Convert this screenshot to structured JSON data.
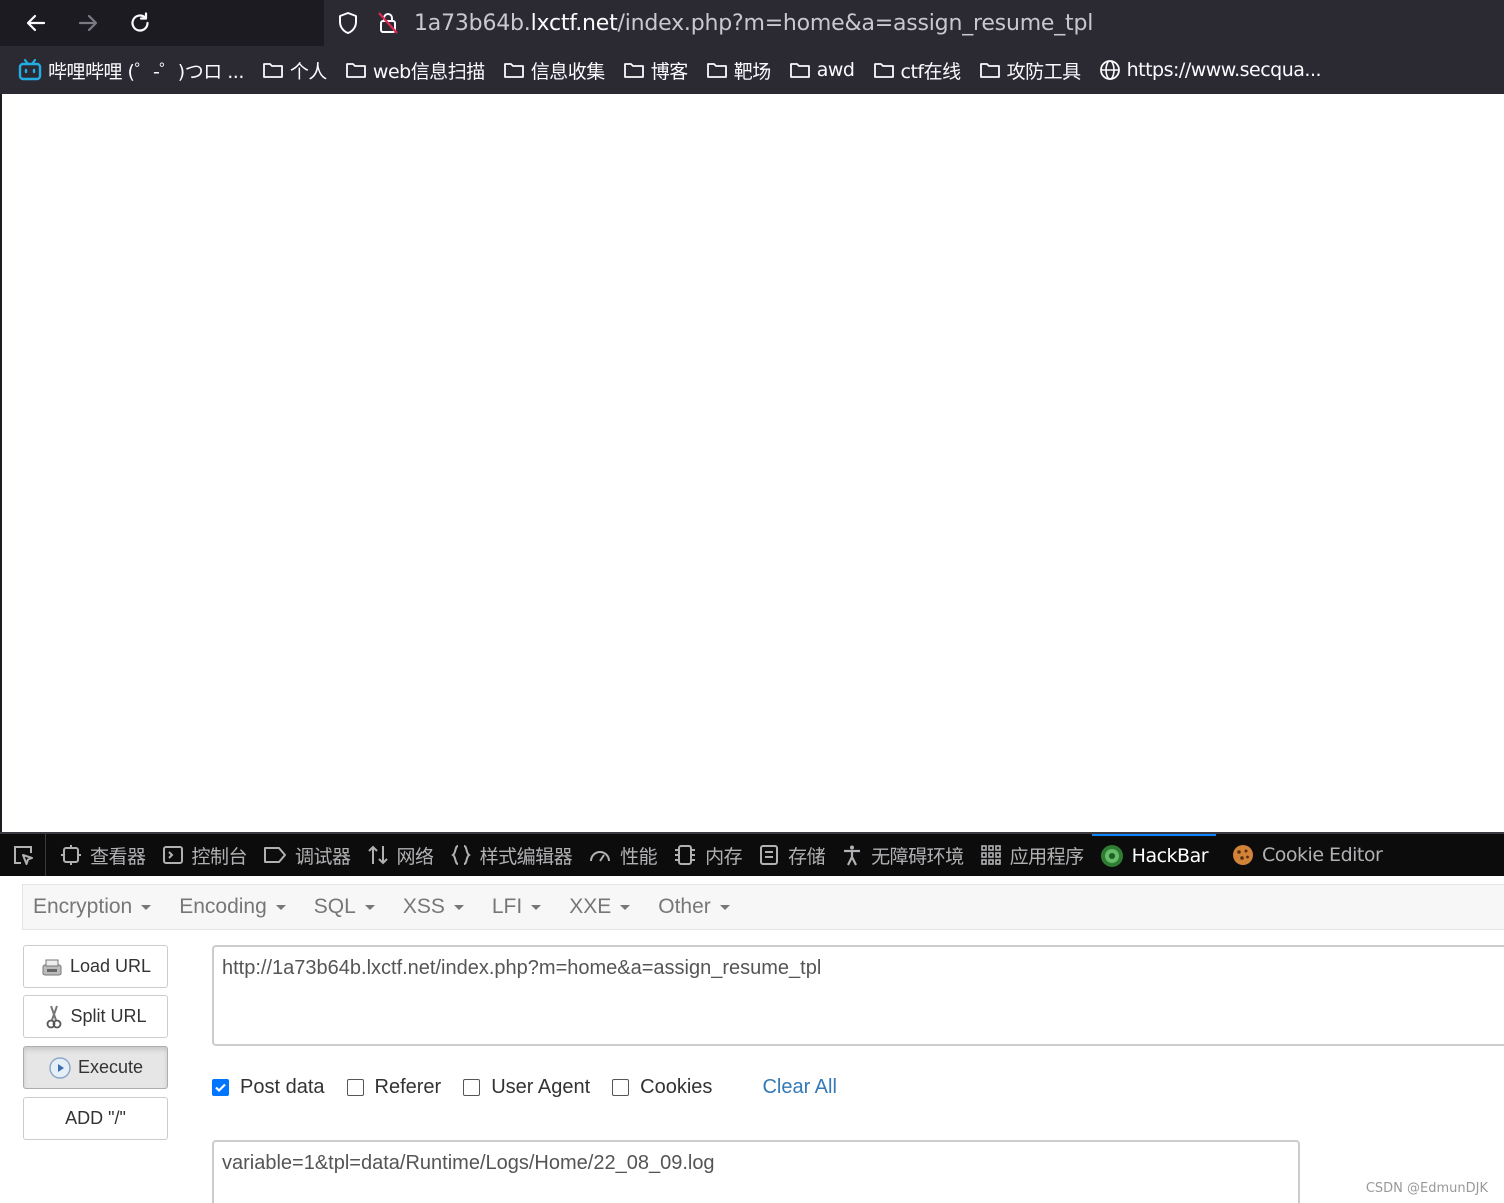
{
  "browser": {
    "url_prefix": "1a73b64b.",
    "url_host": "lxctf.net",
    "url_path": "/index.php?m=home&a=assign_resume_tpl",
    "bookmarks": [
      {
        "label": "哔哩哔哩 (゜-゜)つロ ...",
        "icon": "bilibili-icon"
      },
      {
        "label": "个人",
        "icon": "folder-icon"
      },
      {
        "label": "web信息扫描",
        "icon": "folder-icon"
      },
      {
        "label": "信息收集",
        "icon": "folder-icon"
      },
      {
        "label": "博客",
        "icon": "folder-icon"
      },
      {
        "label": "靶场",
        "icon": "folder-icon"
      },
      {
        "label": "awd",
        "icon": "folder-icon"
      },
      {
        "label": "ctf在线",
        "icon": "folder-icon"
      },
      {
        "label": "攻防工具",
        "icon": "folder-icon"
      },
      {
        "label": "https://www.secqua...",
        "icon": "globe-icon"
      }
    ]
  },
  "devtools": {
    "tabs": [
      {
        "label": "查看器",
        "icon": "inspector-icon"
      },
      {
        "label": "控制台",
        "icon": "console-icon"
      },
      {
        "label": "调试器",
        "icon": "debugger-icon"
      },
      {
        "label": "网络",
        "icon": "network-icon"
      },
      {
        "label": "样式编辑器",
        "icon": "style-editor-icon"
      },
      {
        "label": "性能",
        "icon": "performance-icon"
      },
      {
        "label": "内存",
        "icon": "memory-icon"
      },
      {
        "label": "存储",
        "icon": "storage-icon"
      },
      {
        "label": "无障碍环境",
        "icon": "accessibility-icon"
      },
      {
        "label": "应用程序",
        "icon": "application-icon"
      },
      {
        "label": "HackBar",
        "icon": "hackbar-icon"
      },
      {
        "label": "Cookie Editor",
        "icon": "cookie-icon"
      }
    ],
    "active_tab": "HackBar"
  },
  "hackbar": {
    "menu": [
      "Encryption",
      "Encoding",
      "SQL",
      "XSS",
      "LFI",
      "XXE",
      "Other"
    ],
    "buttons": {
      "load_url": "Load URL",
      "split_url": "Split URL",
      "execute": "Execute",
      "add_slash": "ADD \"/\""
    },
    "url_value": "http://1a73b64b.lxctf.net/index.php?m=home&a=assign_resume_tpl",
    "options": {
      "post_data": {
        "label": "Post data",
        "checked": true
      },
      "referer": {
        "label": "Referer",
        "checked": false
      },
      "user_agent": {
        "label": "User Agent",
        "checked": false
      },
      "cookies": {
        "label": "Cookies",
        "checked": false
      }
    },
    "clear_all": "Clear All",
    "post_value": "variable=1&tpl=data/Runtime/Logs/Home/22_08_09.log"
  },
  "watermark": "CSDN @EdmunDJK",
  "colors": {
    "accent": "#0a84ff",
    "link": "#337ab7",
    "checkbox": "#0075ff"
  }
}
